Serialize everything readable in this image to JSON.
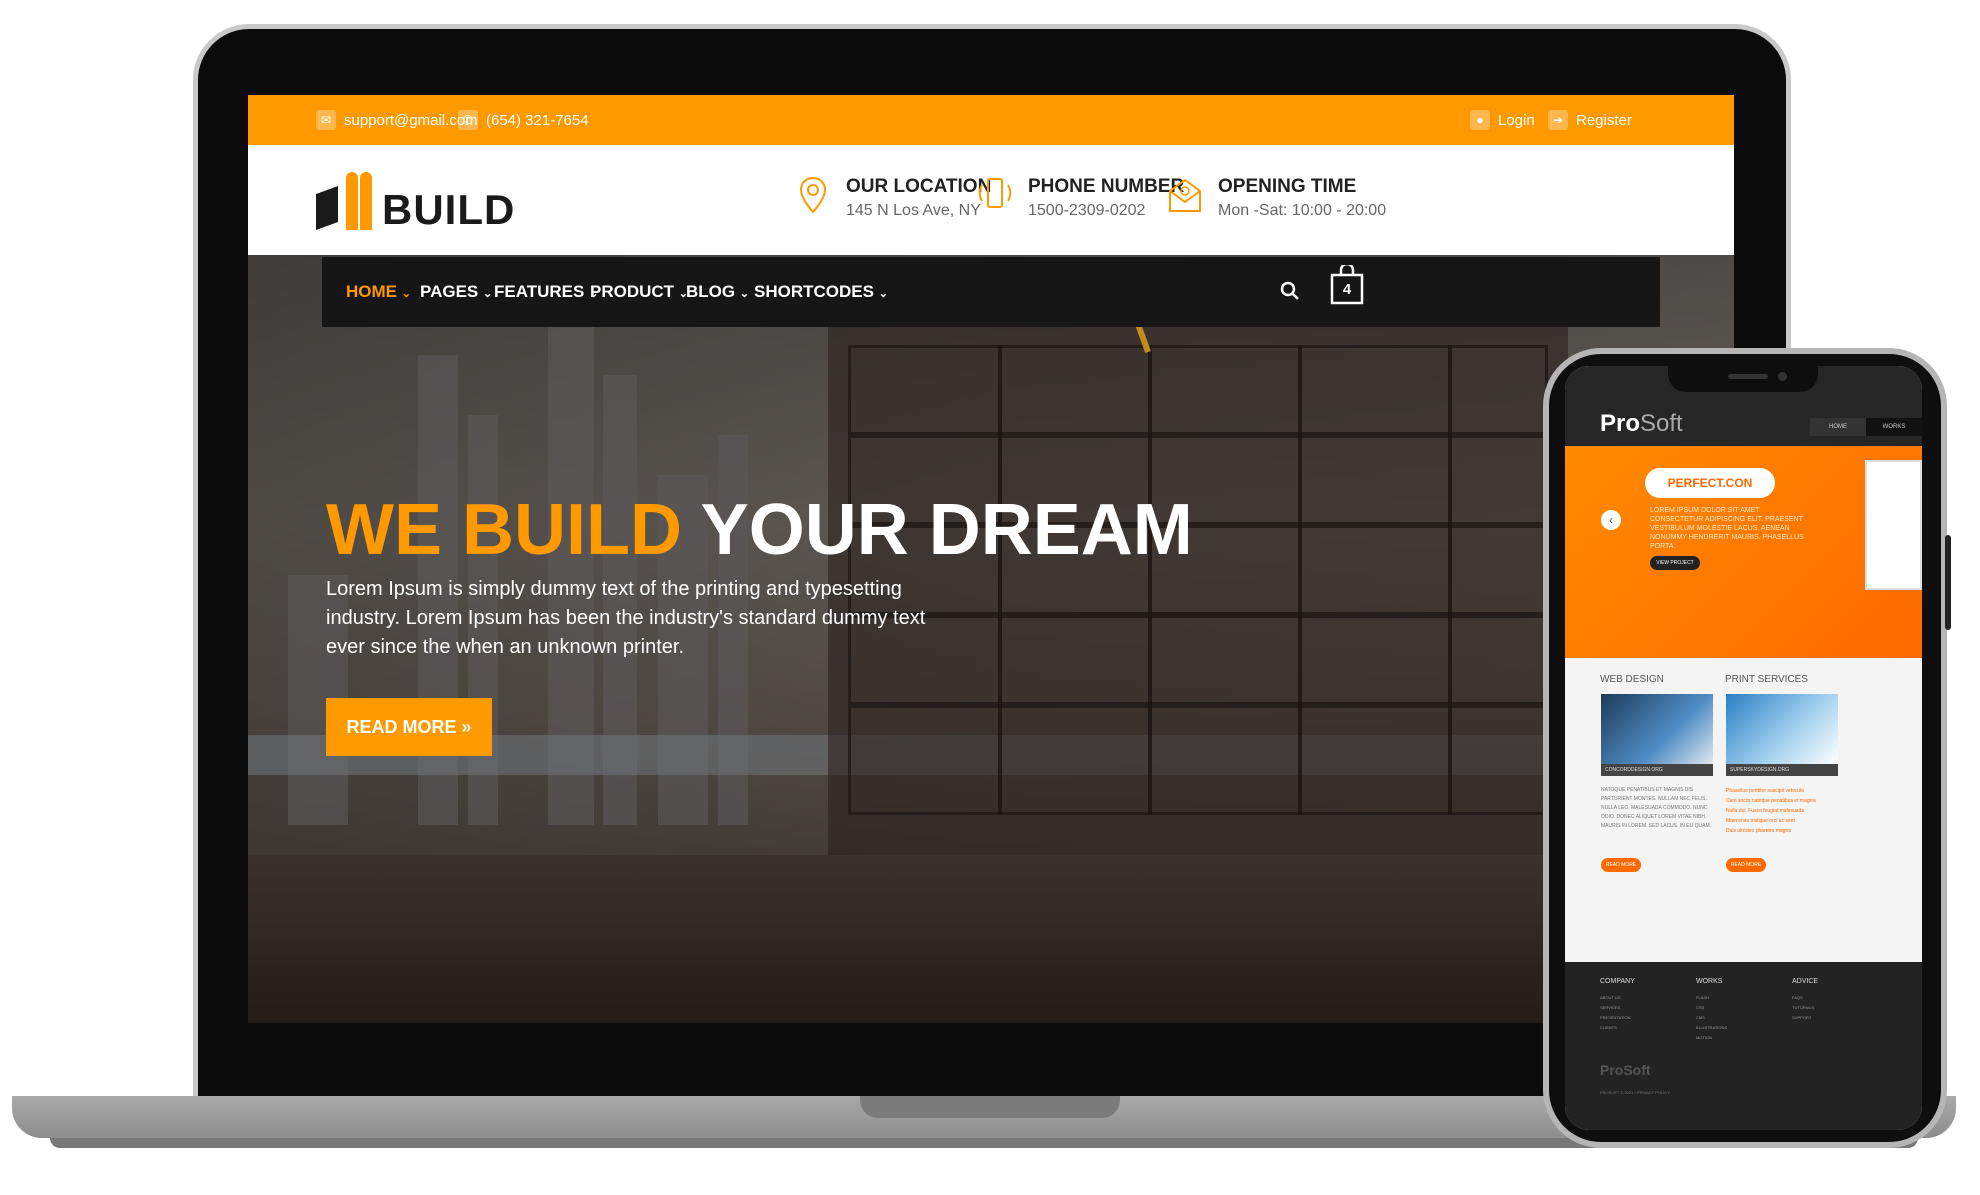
{
  "topbar": {
    "email": "support@gmail.com",
    "phone": "(654) 321-7654",
    "login": "Login",
    "register": "Register"
  },
  "header": {
    "logo_text": "BUILD",
    "info": [
      {
        "icon": "map-pin-icon",
        "title": "OUR LOCATION",
        "sub": "145 N Los Ave, NY"
      },
      {
        "icon": "phone-icon",
        "title": "PHONE NUMBER",
        "sub": "1500-2309-0202"
      },
      {
        "icon": "envelope-icon",
        "title": "OPENING TIME",
        "sub": "Mon -Sat: 10:00 - 20:00"
      }
    ]
  },
  "nav": {
    "items": [
      "HOME",
      "PAGES",
      "FEATURES",
      "PRODUCT",
      "BLOG",
      "SHORTCODES"
    ],
    "active": "HOME",
    "cart_count": "4"
  },
  "hero": {
    "title_accent": "WE BUILD",
    "title_rest": "YOUR DREAM",
    "desc": "Lorem Ipsum is simply dummy text of the printing and typesetting industry. Lorem Ipsum has been the industry's standard dummy text ever since the when an unknown printer.",
    "cta": "READ MORE »"
  },
  "phone": {
    "logo_a": "Pro",
    "logo_b": "Soft",
    "tabs": [
      "HOME",
      "WORKS"
    ],
    "banner_brand": "PERFECT.CON",
    "banner_text": "LOREM IPSUM DOLOR SIT AMET CONSECTETUR ADIPISCING ELIT. PRAESENT VESTIBULUM MOLESTIE LACUS. AENEAN NONUMMY HENDRERIT MAURIS. PHASELLUS PORTA.",
    "banner_btn": "VIEW PROJECT",
    "col1_title": "WEB DESIGN",
    "col2_title": "PRINT SERVICES",
    "col1_img_caption": "CONCORDDESIGN.ORG",
    "col2_img_caption": "SUPERSKYDESIGN.ORG",
    "col1_text": "NATOQUE PENATIBUS ET MAGNIS DIS PARTURIENT MONTES. NULLAM NEC FELIS. NULLA LEO. MALESUADA COMMODO. NUNC ODIO. DONEC ALIQUET LOREM VITAE NIBH. MAURIS IN LOREM. SED LACUS. IN EU QUAM.",
    "col2_links": [
      "Phasellus porttitor suscipit vehicula",
      "Cum sociis natoque penatibus et magnis",
      "Nulla dui. Fusce feugiat malesuada",
      "Maecenas tristique orci ac sem",
      "Duis ultricies pharetra magna"
    ],
    "read_more": "READ MORE",
    "footer_cols": [
      {
        "title": "COMPANY",
        "items": [
          "ABOUT US",
          "SERVICES",
          "PRESENTATION",
          "CLIENTS"
        ]
      },
      {
        "title": "WORKS",
        "items": [
          "FLASH",
          "CSS",
          "CMS",
          "ILLUSTRATIONS",
          "MOTION"
        ]
      },
      {
        "title": "ADVICE",
        "items": [
          "FAQS",
          "TUTORIALS",
          "SUPPORT"
        ]
      }
    ],
    "footer_logo": "ProSoft",
    "copyright": "PROSOFT © 2021 • PRIVACY POLICY"
  },
  "colors": {
    "accent": "#ff9900",
    "dark": "#161616"
  }
}
